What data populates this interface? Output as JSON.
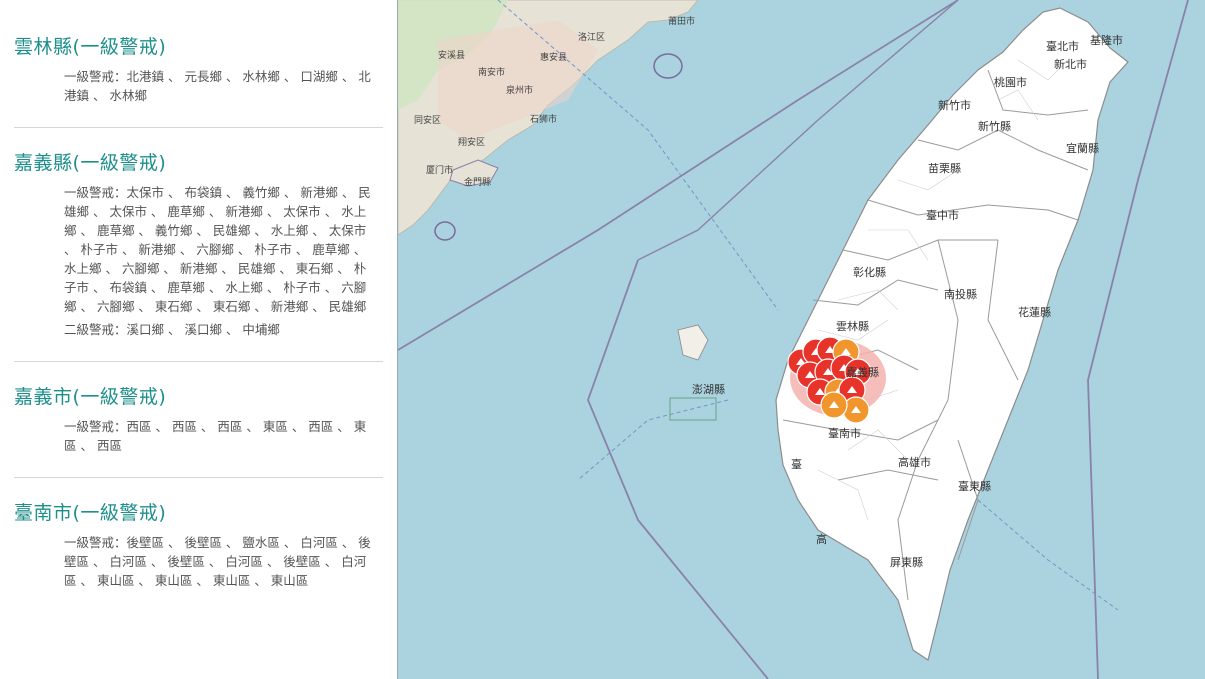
{
  "regions": [
    {
      "title": "雲林縣(一級警戒)",
      "lines": [
        "一級警戒：北港鎮 、 元長鄉 、 水林鄉 、 口湖鄉 、 北港鎮 、 水林鄉"
      ]
    },
    {
      "title": "嘉義縣(一級警戒)",
      "lines": [
        "一級警戒：太保市 、 布袋鎮 、 義竹鄉 、 新港鄉 、 民雄鄉 、 太保市 、 鹿草鄉 、 新港鄉 、 太保市 、 水上鄉 、 鹿草鄉 、 義竹鄉 、 民雄鄉 、 水上鄉 、 太保市 、 朴子市 、 新港鄉 、 六腳鄉 、 朴子市 、 鹿草鄉 、 水上鄉 、 六腳鄉 、 新港鄉 、 民雄鄉 、 東石鄉 、 朴子市 、 布袋鎮 、 鹿草鄉 、 水上鄉 、 朴子市 、 六腳鄉 、 六腳鄉 、 東石鄉 、 東石鄉 、 新港鄉 、 民雄鄉",
        "二級警戒：溪口鄉 、 溪口鄉 、 中埔鄉"
      ]
    },
    {
      "title": "嘉義市(一級警戒)",
      "lines": [
        "一級警戒：西區 、 西區 、 西區 、 東區 、 西區 、 東區 、 西區"
      ]
    },
    {
      "title": "臺南市(一級警戒)",
      "lines": [
        "一級警戒：後壁區 、 後壁區 、 鹽水區 、 白河區 、 後壁區 、 白河區 、 後壁區 、 白河區 、 後壁區 、 白河區 、 東山區 、 東山區 、 東山區 、 東山區"
      ]
    }
  ],
  "map": {
    "taiwan_labels": [
      {
        "id": "taipei",
        "text": "臺北市"
      },
      {
        "id": "keelung",
        "text": "基隆市"
      },
      {
        "id": "newtaipei",
        "text": "新北市"
      },
      {
        "id": "taoyuan",
        "text": "桃園市"
      },
      {
        "id": "hsinchucity",
        "text": "新竹市"
      },
      {
        "id": "hsinchucounty",
        "text": "新竹縣"
      },
      {
        "id": "yilan",
        "text": "宜蘭縣"
      },
      {
        "id": "miaoli",
        "text": "苗栗縣"
      },
      {
        "id": "taichung",
        "text": "臺中市"
      },
      {
        "id": "changhua",
        "text": "彰化縣"
      },
      {
        "id": "nantou",
        "text": "南投縣"
      },
      {
        "id": "hualien",
        "text": "花蓮縣"
      },
      {
        "id": "yunlin",
        "text": "雲林縣"
      },
      {
        "id": "chiayi",
        "text": "嘉義縣"
      },
      {
        "id": "penghu",
        "text": "澎湖縣"
      },
      {
        "id": "tainan",
        "text": "臺南市"
      },
      {
        "id": "kaohsiung",
        "text": "高雄市"
      },
      {
        "id": "taitung",
        "text": "臺東縣"
      },
      {
        "id": "pingtung",
        "text": "屏東縣"
      },
      {
        "id": "gao",
        "text": "高"
      },
      {
        "id": "tai",
        "text": "臺"
      }
    ],
    "china_labels": [
      {
        "id": "quanzhou",
        "text": "泉州市"
      },
      {
        "id": "xiamen",
        "text": "厦门市"
      },
      {
        "id": "kinmen",
        "text": "金門縣"
      },
      {
        "id": "nanan",
        "text": "南安市"
      },
      {
        "id": "shishi",
        "text": "石狮市"
      },
      {
        "id": "huian",
        "text": "惠安县"
      },
      {
        "id": "anxi",
        "text": "安溪县"
      },
      {
        "id": "tongan",
        "text": "同安区"
      },
      {
        "id": "xiangan",
        "text": "翔安区"
      },
      {
        "id": "luojiang",
        "text": "洛江区"
      },
      {
        "id": "putian",
        "text": "莆田市"
      }
    ],
    "alert_colors": {
      "level1": "#e8332a",
      "level2": "#f0962d",
      "zone": "#f3b3ae"
    }
  }
}
